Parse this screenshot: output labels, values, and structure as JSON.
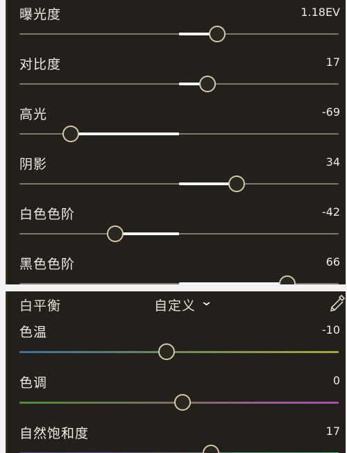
{
  "light": {
    "items": [
      {
        "label": "曝光度",
        "value": "1.18EV",
        "level": 0.62
      },
      {
        "label": "对比度",
        "value": "17",
        "level": 0.59
      },
      {
        "label": "高光",
        "value": "-69",
        "level": 0.16
      },
      {
        "label": "阴影",
        "value": "34",
        "level": 0.68
      },
      {
        "label": "白色色阶",
        "value": "-42",
        "level": 0.3
      },
      {
        "label": "黑色色阶",
        "value": "66",
        "level": 0.84
      }
    ]
  },
  "white_balance": {
    "title": "白平衡",
    "preset": "自定义",
    "chevron_icon": "chevron-down-icon",
    "picker_icon": "eyedropper-icon",
    "items": [
      {
        "label": "色温",
        "value": "-10",
        "level": 0.46,
        "gradient": [
          "#3a6f9f",
          "#6e8c5a",
          "#a7a53e"
        ]
      },
      {
        "label": "色调",
        "value": "0",
        "level": 0.51,
        "gradient": [
          "#4f8a3c",
          "#7d6f6a",
          "#a84fae"
        ]
      },
      {
        "label": "自然饱和度",
        "value": "17",
        "level": 0.6,
        "gradient": [
          "#5a4f8f",
          "#6a7f8c",
          "#3fbf6f"
        ]
      }
    ]
  }
}
